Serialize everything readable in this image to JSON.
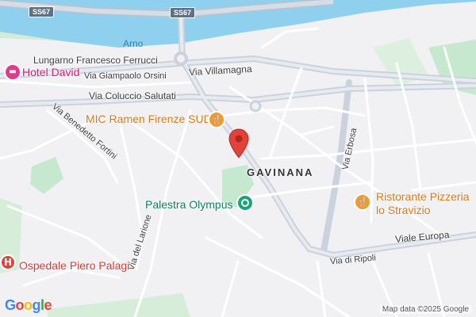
{
  "map": {
    "colors": {
      "land": "#f1f1f4",
      "water": "#8ed0ed",
      "major_road": "#c9d2dd",
      "minor_road": "#ffffff",
      "park": "#c6e8cf",
      "food_poi": "#f09a35",
      "green_poi": "#17a67a",
      "hotel_poi": "#e03b8b",
      "hospital_poi": "#e0433a",
      "pin": "#e2423a"
    },
    "shields": [
      "SS67",
      "SS67"
    ],
    "water_label": "Arno",
    "roads": [
      "Lungarno Francesco Ferrucci",
      "Via Villamagna",
      "Via Giampaolo Orsini",
      "Via Coluccio Salutati",
      "Via Benedetto Fortini",
      "Via Erbosa",
      "Viale Europa",
      "Via di Ripoli",
      "Via del Larione"
    ],
    "district": "GAVINANA",
    "pois": {
      "hotel": "Hotel David",
      "ramen": "MIC Ramen Firenze SUD",
      "gym": "Palestra Olympus",
      "restaurant_line1": "Ristorante Pizzeria",
      "restaurant_line2": "lo Stravizio",
      "hospital": "Ospedale Piero Palagi"
    },
    "icons": {
      "food": "fork-knife-icon",
      "gym": "dot-icon",
      "hotel": "bed-icon",
      "hospital": "H"
    },
    "logo_letters": [
      "G",
      "o",
      "o",
      "g",
      "l",
      "e"
    ],
    "logo_colors": [
      "#4285f4",
      "#ea4335",
      "#fbbc05",
      "#4285f4",
      "#34a853",
      "#ea4335"
    ],
    "attribution": "Map data ©2025 Google"
  }
}
